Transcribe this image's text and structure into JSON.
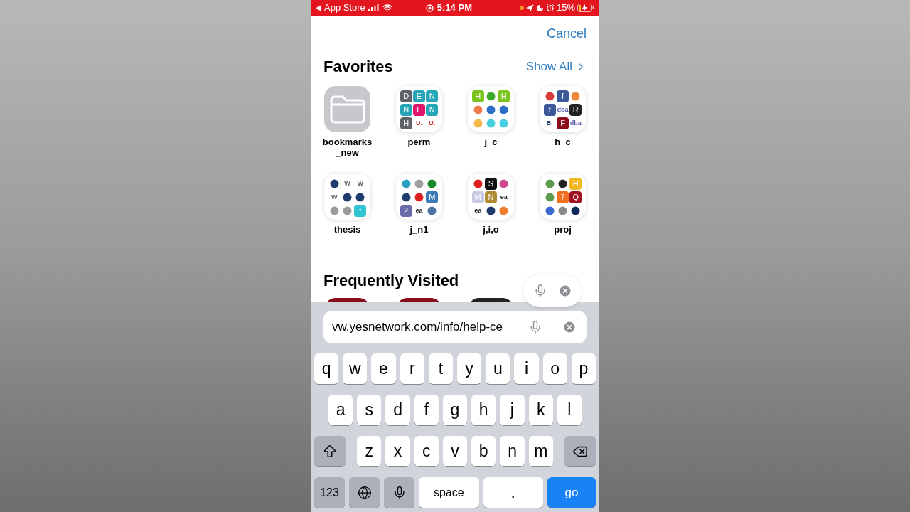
{
  "status_bar": {
    "back_app": "App Store",
    "time": "5:14 PM",
    "battery": "15%"
  },
  "cancel": "Cancel",
  "favorites": {
    "title": "Favorites",
    "show_all": "Show All",
    "folders": [
      {
        "name": "bookmarks_new",
        "kind": "folder"
      },
      {
        "name": "perm",
        "kind": "collection",
        "tiles": [
          {
            "kind": "tile",
            "text": "D",
            "color": "#5f6368"
          },
          {
            "kind": "tile",
            "text": "E",
            "color": "#26a5b8"
          },
          {
            "kind": "tile",
            "text": "N",
            "color": "#26a5b8"
          },
          {
            "kind": "tile",
            "text": "N",
            "color": "#26a5b8"
          },
          {
            "kind": "tile",
            "text": "F",
            "color": "#e0156b"
          },
          {
            "kind": "tile",
            "text": "N",
            "color": "#26a5b8"
          },
          {
            "kind": "tile",
            "text": "H",
            "color": "#5f6368"
          },
          {
            "kind": "text",
            "text": "U.",
            "color": "#d03a3a"
          },
          {
            "kind": "text",
            "text": "U.",
            "color": "#d03a3a"
          }
        ]
      },
      {
        "name": "j_c",
        "kind": "collection",
        "tiles": [
          {
            "kind": "tile",
            "text": "H",
            "color": "#7bc31f"
          },
          {
            "kind": "glyph",
            "color": "#3aa828"
          },
          {
            "kind": "tile",
            "text": "H",
            "color": "#7bc31f"
          },
          {
            "kind": "glyph",
            "color": "#f07a4a"
          },
          {
            "kind": "glyph",
            "color": "#2a6ec8"
          },
          {
            "kind": "glyph",
            "color": "#2a6ec8"
          },
          {
            "kind": "glyph",
            "color": "#f2b84a"
          },
          {
            "kind": "glyph",
            "color": "#48d0e0"
          },
          {
            "kind": "glyph",
            "color": "#48d0e0"
          }
        ]
      },
      {
        "name": "h_c",
        "kind": "collection",
        "tiles": [
          {
            "kind": "glyph",
            "color": "#d83a3a"
          },
          {
            "kind": "tile",
            "text": "f",
            "color": "#3b5998"
          },
          {
            "kind": "glyph",
            "color": "#f08a3a"
          },
          {
            "kind": "tile",
            "text": "f",
            "color": "#3b5998"
          },
          {
            "kind": "text",
            "text": "dba",
            "color": "#5a5ab0"
          },
          {
            "kind": "tile",
            "text": "R",
            "color": "#222222"
          },
          {
            "kind": "text",
            "text": "B.",
            "color": "#1e3c78"
          },
          {
            "kind": "tile",
            "text": "F",
            "color": "#8b0f1a"
          },
          {
            "kind": "text",
            "text": "dba",
            "color": "#5a5ab0"
          }
        ]
      },
      {
        "name": "thesis",
        "kind": "collection",
        "tiles": [
          {
            "kind": "glyph",
            "color": "#1e3c6e"
          },
          {
            "kind": "text",
            "text": "W",
            "color": "#666666"
          },
          {
            "kind": "text",
            "text": "W",
            "color": "#666666"
          },
          {
            "kind": "text",
            "text": "W",
            "color": "#666666"
          },
          {
            "kind": "glyph",
            "color": "#1e3c6e"
          },
          {
            "kind": "glyph",
            "color": "#1e3c6e"
          },
          {
            "kind": "glyph",
            "color": "#9a9a9a"
          },
          {
            "kind": "glyph",
            "color": "#9a9a9a"
          },
          {
            "kind": "tile",
            "text": "t",
            "color": "#2ec4d0"
          }
        ]
      },
      {
        "name": "j_n1",
        "kind": "collection",
        "tiles": [
          {
            "kind": "glyph",
            "color": "#2aa0c0"
          },
          {
            "kind": "glyph",
            "color": "#a0a0a0"
          },
          {
            "kind": "glyph",
            "color": "#1a8a2a"
          },
          {
            "kind": "glyph",
            "color": "#1e3c6e"
          },
          {
            "kind": "glyph",
            "color": "#e02020"
          },
          {
            "kind": "tile",
            "text": "M",
            "color": "#3d7ab8"
          },
          {
            "kind": "tile",
            "text": "2",
            "color": "#6a6aa8"
          },
          {
            "kind": "text",
            "text": "ea",
            "color": "#222222"
          },
          {
            "kind": "glyph",
            "color": "#4c75a3"
          }
        ]
      },
      {
        "name": "j,i,o",
        "kind": "collection",
        "tiles": [
          {
            "kind": "glyph",
            "color": "#e02020"
          },
          {
            "kind": "tile",
            "text": "S",
            "color": "#111111"
          },
          {
            "kind": "glyph",
            "color": "#d04a8a"
          },
          {
            "kind": "tile",
            "text": "M",
            "color": "#c8c8e0"
          },
          {
            "kind": "tile",
            "text": "N",
            "color": "#b08a30"
          },
          {
            "kind": "text",
            "text": "ea",
            "color": "#222222"
          },
          {
            "kind": "text",
            "text": "ea",
            "color": "#222222"
          },
          {
            "kind": "glyph",
            "color": "#1e3c6e"
          },
          {
            "kind": "glyph",
            "color": "#f07c2a"
          }
        ]
      },
      {
        "name": "proj",
        "kind": "collection",
        "tiles": [
          {
            "kind": "glyph",
            "color": "#5a9a4a"
          },
          {
            "kind": "glyph",
            "color": "#222222"
          },
          {
            "kind": "tile",
            "text": "H",
            "color": "#f2b824"
          },
          {
            "kind": "glyph",
            "color": "#5a9a4a"
          },
          {
            "kind": "tile",
            "text": "7",
            "color": "#f07020"
          },
          {
            "kind": "tile",
            "text": "Q",
            "color": "#a01020"
          },
          {
            "kind": "glyph",
            "color": "#3a6ad0"
          },
          {
            "kind": "glyph",
            "color": "#888888"
          },
          {
            "kind": "glyph",
            "color": "#0e2a5a"
          }
        ]
      }
    ]
  },
  "frequently_visited": {
    "title": "Frequently Visited",
    "sites": [
      {
        "color": "#8b0f1a"
      },
      {
        "color": "#8b0f1a"
      },
      {
        "color": "#222222"
      }
    ]
  },
  "address_field": {
    "value": "vw.yesnetwork.com/info/help-ce"
  },
  "keyboard": {
    "rows": [
      {
        "keys": [
          {
            "kind": "letter",
            "label": "q"
          },
          {
            "kind": "letter",
            "label": "w"
          },
          {
            "kind": "letter",
            "label": "e"
          },
          {
            "kind": "letter",
            "label": "r"
          },
          {
            "kind": "letter",
            "label": "t"
          },
          {
            "kind": "letter",
            "label": "y"
          },
          {
            "kind": "letter",
            "label": "u"
          },
          {
            "kind": "letter",
            "label": "i"
          },
          {
            "kind": "letter",
            "label": "o"
          },
          {
            "kind": "letter",
            "label": "p"
          }
        ]
      },
      {
        "keys": [
          {
            "kind": "letter",
            "label": "a"
          },
          {
            "kind": "letter",
            "label": "s"
          },
          {
            "kind": "letter",
            "label": "d"
          },
          {
            "kind": "letter",
            "label": "f"
          },
          {
            "kind": "letter",
            "label": "g"
          },
          {
            "kind": "letter",
            "label": "h"
          },
          {
            "kind": "letter",
            "label": "j"
          },
          {
            "kind": "letter",
            "label": "k"
          },
          {
            "kind": "letter",
            "label": "l"
          }
        ]
      },
      {
        "keys": [
          {
            "kind": "shift"
          },
          {
            "kind": "letter",
            "label": "z"
          },
          {
            "kind": "letter",
            "label": "x"
          },
          {
            "kind": "letter",
            "label": "c"
          },
          {
            "kind": "letter",
            "label": "v"
          },
          {
            "kind": "letter",
            "label": "b"
          },
          {
            "kind": "letter",
            "label": "n"
          },
          {
            "kind": "letter",
            "label": "m"
          },
          {
            "kind": "delete"
          }
        ]
      },
      {
        "keys": [
          {
            "kind": "mode",
            "label": "123"
          },
          {
            "kind": "globe"
          },
          {
            "kind": "mic"
          },
          {
            "kind": "space",
            "label": "space"
          },
          {
            "kind": "letter",
            "label": "."
          },
          {
            "kind": "go",
            "label": "go"
          }
        ]
      }
    ]
  }
}
